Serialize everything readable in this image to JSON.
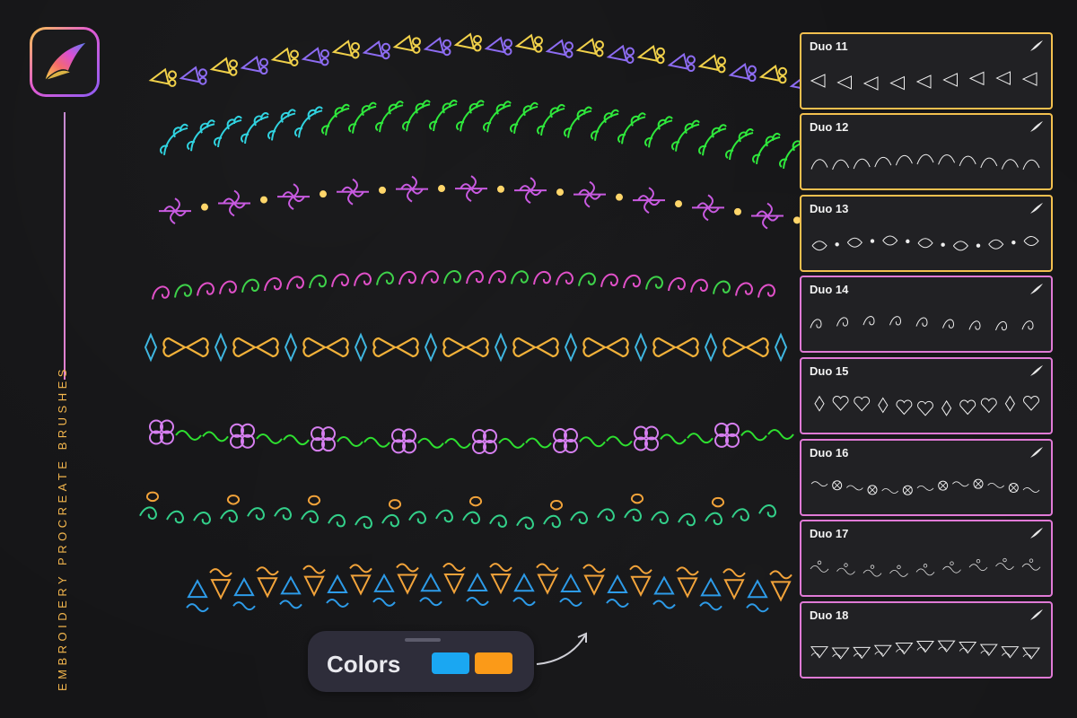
{
  "app": {
    "icon": "procreate-brush-icon",
    "side_title": "EMBROIDERY PROCREATE BRUSHES"
  },
  "brush_panels": [
    {
      "name": "Duo 11",
      "border_color": "#f3c04f"
    },
    {
      "name": "Duo 12",
      "border_color": "#f3c04f"
    },
    {
      "name": "Duo 13",
      "border_color": "#f3c04f"
    },
    {
      "name": "Duo 14",
      "border_color": "#e07ad6"
    },
    {
      "name": "Duo 15",
      "border_color": "#e07ad6"
    },
    {
      "name": "Duo 16",
      "border_color": "#e07ad6"
    },
    {
      "name": "Duo 17",
      "border_color": "#e07ad6"
    },
    {
      "name": "Duo 18",
      "border_color": "#e07ad6"
    }
  ],
  "color_picker": {
    "label": "Colors",
    "primary_color": "#1aa7f2",
    "secondary_color": "#fb9a18"
  },
  "stroke_colors": {
    "duo11": [
      "#8d6cf2",
      "#f1d14a"
    ],
    "duo12": [
      "#30d3e0",
      "#2fe83c"
    ],
    "duo13": [
      "#c85ae0",
      "#ffd66a"
    ],
    "duo14": [
      "#e050c8",
      "#3ed24a"
    ],
    "duo15": [
      "#f3b23a",
      "#3fb6e0"
    ],
    "duo16": [
      "#d67ff0",
      "#2ee030"
    ],
    "duo17": [
      "#33d08a",
      "#f2a33a"
    ],
    "duo18": [
      "#f2a33a",
      "#2d9be8"
    ]
  }
}
